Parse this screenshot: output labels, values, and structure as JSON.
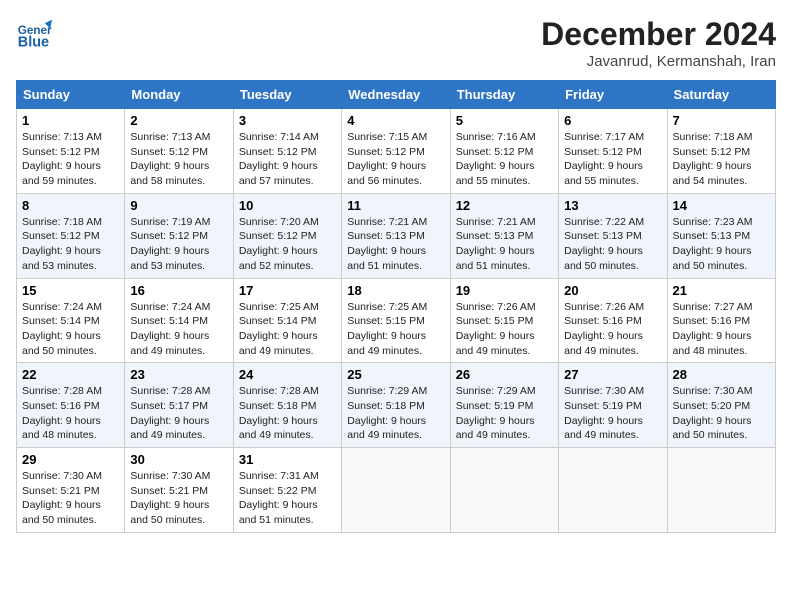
{
  "logo": {
    "general": "General",
    "blue": "Blue"
  },
  "title": {
    "month": "December 2024",
    "location": "Javanrud, Kermanshah, Iran"
  },
  "calendar": {
    "headers": [
      "Sunday",
      "Monday",
      "Tuesday",
      "Wednesday",
      "Thursday",
      "Friday",
      "Saturday"
    ],
    "weeks": [
      [
        {
          "day": "1",
          "sunrise": "7:13 AM",
          "sunset": "5:12 PM",
          "daylight": "9 hours and 59 minutes."
        },
        {
          "day": "2",
          "sunrise": "7:13 AM",
          "sunset": "5:12 PM",
          "daylight": "9 hours and 58 minutes."
        },
        {
          "day": "3",
          "sunrise": "7:14 AM",
          "sunset": "5:12 PM",
          "daylight": "9 hours and 57 minutes."
        },
        {
          "day": "4",
          "sunrise": "7:15 AM",
          "sunset": "5:12 PM",
          "daylight": "9 hours and 56 minutes."
        },
        {
          "day": "5",
          "sunrise": "7:16 AM",
          "sunset": "5:12 PM",
          "daylight": "9 hours and 55 minutes."
        },
        {
          "day": "6",
          "sunrise": "7:17 AM",
          "sunset": "5:12 PM",
          "daylight": "9 hours and 55 minutes."
        },
        {
          "day": "7",
          "sunrise": "7:18 AM",
          "sunset": "5:12 PM",
          "daylight": "9 hours and 54 minutes."
        }
      ],
      [
        {
          "day": "8",
          "sunrise": "7:18 AM",
          "sunset": "5:12 PM",
          "daylight": "9 hours and 53 minutes."
        },
        {
          "day": "9",
          "sunrise": "7:19 AM",
          "sunset": "5:12 PM",
          "daylight": "9 hours and 53 minutes."
        },
        {
          "day": "10",
          "sunrise": "7:20 AM",
          "sunset": "5:12 PM",
          "daylight": "9 hours and 52 minutes."
        },
        {
          "day": "11",
          "sunrise": "7:21 AM",
          "sunset": "5:13 PM",
          "daylight": "9 hours and 51 minutes."
        },
        {
          "day": "12",
          "sunrise": "7:21 AM",
          "sunset": "5:13 PM",
          "daylight": "9 hours and 51 minutes."
        },
        {
          "day": "13",
          "sunrise": "7:22 AM",
          "sunset": "5:13 PM",
          "daylight": "9 hours and 50 minutes."
        },
        {
          "day": "14",
          "sunrise": "7:23 AM",
          "sunset": "5:13 PM",
          "daylight": "9 hours and 50 minutes."
        }
      ],
      [
        {
          "day": "15",
          "sunrise": "7:24 AM",
          "sunset": "5:14 PM",
          "daylight": "9 hours and 50 minutes."
        },
        {
          "day": "16",
          "sunrise": "7:24 AM",
          "sunset": "5:14 PM",
          "daylight": "9 hours and 49 minutes."
        },
        {
          "day": "17",
          "sunrise": "7:25 AM",
          "sunset": "5:14 PM",
          "daylight": "9 hours and 49 minutes."
        },
        {
          "day": "18",
          "sunrise": "7:25 AM",
          "sunset": "5:15 PM",
          "daylight": "9 hours and 49 minutes."
        },
        {
          "day": "19",
          "sunrise": "7:26 AM",
          "sunset": "5:15 PM",
          "daylight": "9 hours and 49 minutes."
        },
        {
          "day": "20",
          "sunrise": "7:26 AM",
          "sunset": "5:16 PM",
          "daylight": "9 hours and 49 minutes."
        },
        {
          "day": "21",
          "sunrise": "7:27 AM",
          "sunset": "5:16 PM",
          "daylight": "9 hours and 48 minutes."
        }
      ],
      [
        {
          "day": "22",
          "sunrise": "7:28 AM",
          "sunset": "5:16 PM",
          "daylight": "9 hours and 48 minutes."
        },
        {
          "day": "23",
          "sunrise": "7:28 AM",
          "sunset": "5:17 PM",
          "daylight": "9 hours and 49 minutes."
        },
        {
          "day": "24",
          "sunrise": "7:28 AM",
          "sunset": "5:18 PM",
          "daylight": "9 hours and 49 minutes."
        },
        {
          "day": "25",
          "sunrise": "7:29 AM",
          "sunset": "5:18 PM",
          "daylight": "9 hours and 49 minutes."
        },
        {
          "day": "26",
          "sunrise": "7:29 AM",
          "sunset": "5:19 PM",
          "daylight": "9 hours and 49 minutes."
        },
        {
          "day": "27",
          "sunrise": "7:30 AM",
          "sunset": "5:19 PM",
          "daylight": "9 hours and 49 minutes."
        },
        {
          "day": "28",
          "sunrise": "7:30 AM",
          "sunset": "5:20 PM",
          "daylight": "9 hours and 50 minutes."
        }
      ],
      [
        {
          "day": "29",
          "sunrise": "7:30 AM",
          "sunset": "5:21 PM",
          "daylight": "9 hours and 50 minutes."
        },
        {
          "day": "30",
          "sunrise": "7:30 AM",
          "sunset": "5:21 PM",
          "daylight": "9 hours and 50 minutes."
        },
        {
          "day": "31",
          "sunrise": "7:31 AM",
          "sunset": "5:22 PM",
          "daylight": "9 hours and 51 minutes."
        },
        null,
        null,
        null,
        null
      ]
    ]
  }
}
